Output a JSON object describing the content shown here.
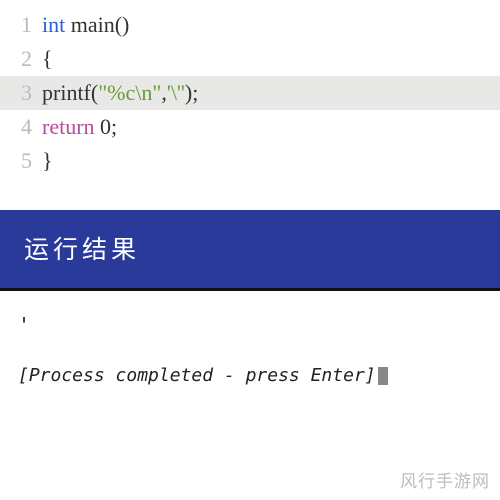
{
  "code": {
    "lines": [
      {
        "num": "1",
        "highlighted": false,
        "tokens": [
          {
            "cls": "kw-type",
            "text": "int"
          },
          {
            "cls": "plain",
            "text": " main()"
          }
        ]
      },
      {
        "num": "2",
        "highlighted": false,
        "tokens": [
          {
            "cls": "plain",
            "text": "{"
          }
        ]
      },
      {
        "num": "3",
        "highlighted": true,
        "tokens": [
          {
            "cls": "plain",
            "text": "printf("
          },
          {
            "cls": "str",
            "text": "\"%c\\n\""
          },
          {
            "cls": "plain",
            "text": ","
          },
          {
            "cls": "chr",
            "text": "'\\''"
          },
          {
            "cls": "plain",
            "text": ");"
          }
        ]
      },
      {
        "num": "4",
        "highlighted": false,
        "tokens": [
          {
            "cls": "kw-return",
            "text": "return"
          },
          {
            "cls": "plain",
            "text": " 0;"
          }
        ]
      },
      {
        "num": "5",
        "highlighted": false,
        "tokens": [
          {
            "cls": "plain",
            "text": "}"
          }
        ]
      }
    ]
  },
  "run_header": "运行结果",
  "output": {
    "line1": "'",
    "line2": "[Process completed - press Enter]"
  },
  "watermark": "风行手游网"
}
